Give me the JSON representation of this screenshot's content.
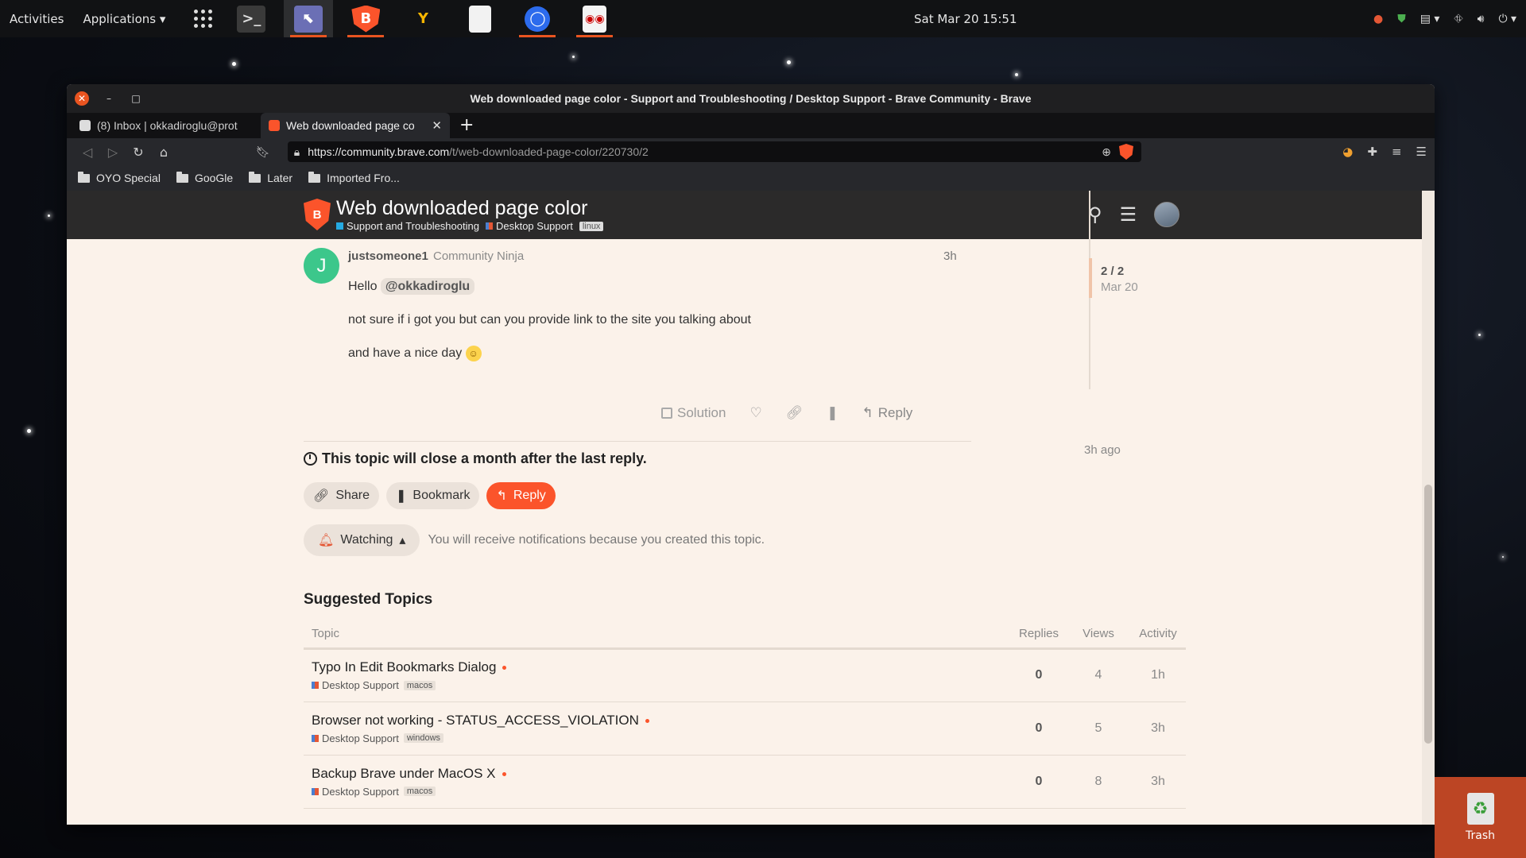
{
  "topbar": {
    "activities": "Activities",
    "applications": "Applications",
    "datetime": "Sat Mar 20  15:51",
    "dock": [
      "terminal-icon",
      "screenshot-tool-icon",
      "brave-browser-icon",
      "yandex-browser-icon",
      "text-editor-icon",
      "signal-icon",
      "document-viewer-icon"
    ]
  },
  "window": {
    "title": "Web downloaded page color - Support and Troubleshooting / Desktop Support - Brave Community - Brave"
  },
  "tabs": [
    {
      "label": "(8) Inbox | okkadiroglu@prot"
    },
    {
      "label": "Web downloaded page co"
    }
  ],
  "urlbar": {
    "host": "https://community.brave.com",
    "path": "/t/web-downloaded-page-color/220730/2"
  },
  "bookmarks": [
    "OYO Special",
    "GooGle",
    "Later",
    "Imported Fro..."
  ],
  "topic": {
    "title": "Web downloaded page color",
    "category": "Support and Troubleshooting",
    "subcategory": "Desktop Support",
    "tag": "linux"
  },
  "post": {
    "avatar_letter": "J",
    "author": "justsomeone1",
    "role": "Community Ninja",
    "time": "3h",
    "greeting": "Hello",
    "mention": "@okkadiroglu",
    "line2": "not sure if i got you but can you provide link to the site you talking about",
    "line3": "and have a nice day",
    "actions": {
      "solution": "Solution",
      "reply": "Reply"
    }
  },
  "timeline": {
    "position": "2 / 2",
    "date": "Mar 20",
    "ago": "3h ago"
  },
  "close_notice": "This topic will close a month after the last reply.",
  "footer_buttons": {
    "share": "Share",
    "bookmark": "Bookmark",
    "reply": "Reply"
  },
  "notifications": {
    "level": "Watching",
    "text": "You will receive notifications because you created this topic."
  },
  "suggested": {
    "title": "Suggested Topics",
    "columns": {
      "topic": "Topic",
      "replies": "Replies",
      "views": "Views",
      "activity": "Activity"
    },
    "rows": [
      {
        "title": "Typo In Edit Bookmarks Dialog",
        "category": "Desktop Support",
        "tag": "macos",
        "replies": "0",
        "views": "4",
        "activity": "1h"
      },
      {
        "title": "Browser not working - STATUS_ACCESS_VIOLATION",
        "category": "Desktop Support",
        "tag": "windows",
        "replies": "0",
        "views": "5",
        "activity": "3h"
      },
      {
        "title": "Backup Brave under MacOS X",
        "category": "Desktop Support",
        "tag": "macos",
        "replies": "0",
        "views": "8",
        "activity": "3h"
      }
    ]
  },
  "desktop": {
    "trash_label": "Trash"
  },
  "colors": {
    "accent": "#fb542b",
    "header": "#2b2a2a",
    "page_bg": "#fbf2ea"
  }
}
